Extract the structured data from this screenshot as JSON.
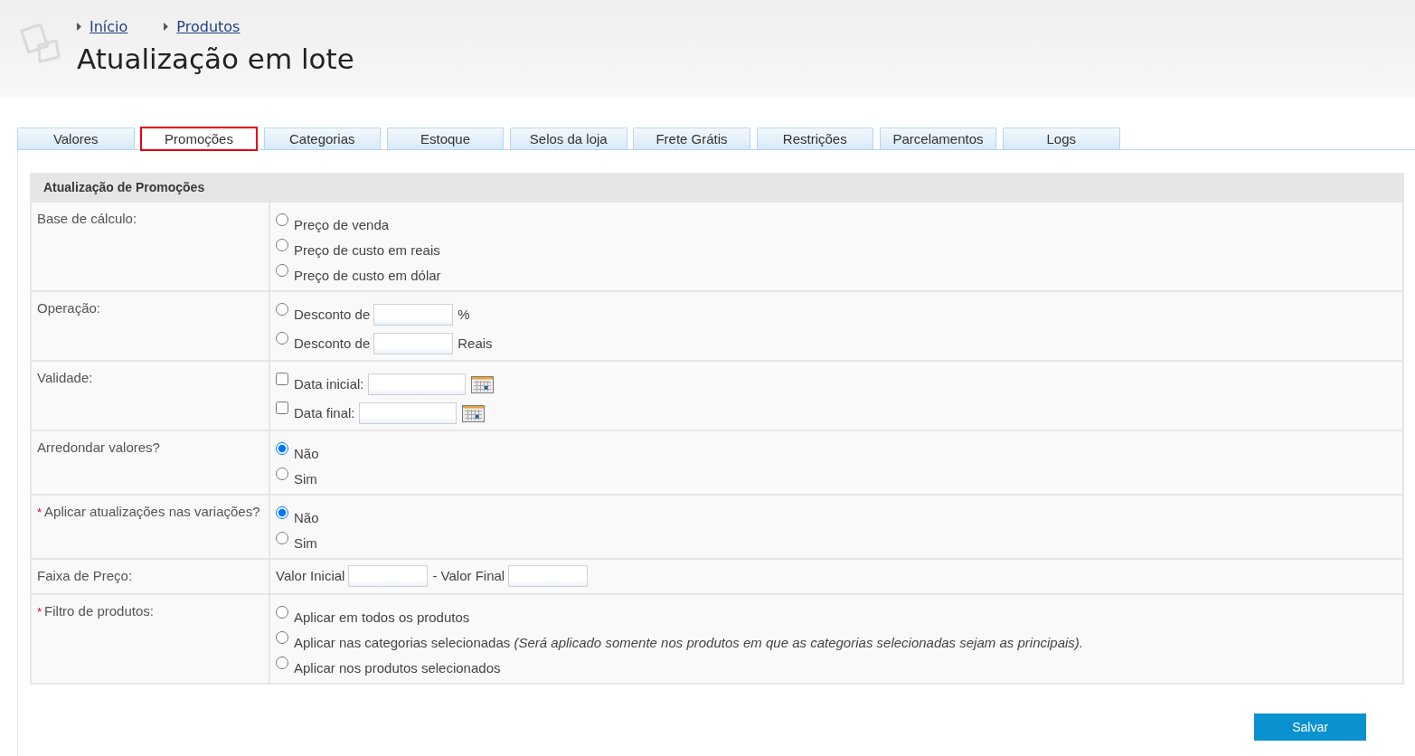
{
  "header": {
    "breadcrumbs": [
      {
        "label": "Início"
      },
      {
        "label": "Produtos"
      }
    ],
    "title": "Atualização em lote"
  },
  "tabs": [
    {
      "label": "Valores",
      "selected": false
    },
    {
      "label": "Promoções",
      "selected": true
    },
    {
      "label": "Categorias",
      "selected": false
    },
    {
      "label": "Estoque",
      "selected": false
    },
    {
      "label": "Selos da loja",
      "selected": false
    },
    {
      "label": "Frete Grátis",
      "selected": false
    },
    {
      "label": "Restrições",
      "selected": false
    },
    {
      "label": "Parcelamentos",
      "selected": false
    },
    {
      "label": "Logs",
      "selected": false
    }
  ],
  "form": {
    "title": "Atualização de Promoções",
    "rows": [
      {
        "label": "Base de cálculo:",
        "kind": "radio",
        "options": [
          {
            "label": "Preço de venda",
            "selected": false
          },
          {
            "label": "Preço de custo em reais",
            "selected": false
          },
          {
            "label": "Preço de custo em dólar",
            "selected": false
          }
        ]
      },
      {
        "label": "Operação:",
        "kind": "radio_input",
        "options": [
          {
            "label": "Desconto de",
            "selected": false,
            "suffix": "%"
          },
          {
            "label": "Desconto de",
            "selected": false,
            "suffix": "Reais"
          }
        ]
      },
      {
        "label": "Validade:",
        "kind": "check_date",
        "options": [
          {
            "label": "Data inicial:",
            "checked": false
          },
          {
            "label": "Data final:",
            "checked": false
          }
        ]
      },
      {
        "label": "Arredondar valores?",
        "kind": "radio",
        "options": [
          {
            "label": "Não",
            "selected": true
          },
          {
            "label": "Sim",
            "selected": false
          }
        ]
      },
      {
        "label": "Aplicar atualizações nas variações?",
        "required_mark": "*",
        "kind": "radio",
        "options": [
          {
            "label": "Não",
            "selected": true
          },
          {
            "label": "Sim",
            "selected": false
          }
        ]
      },
      {
        "label": "Faixa de Preço:",
        "kind": "range",
        "parts": [
          {
            "label": "Valor Inicial"
          },
          {
            "label": "- Valor Final"
          }
        ]
      },
      {
        "label": "Filtro de produtos:",
        "required_mark": "*",
        "kind": "radio",
        "options": [
          {
            "label": "Aplicar em todos os produtos",
            "selected": false
          },
          {
            "label": "Aplicar nas categorias selecionadas *(Será aplicado somente nos produtos em que as categorias selecionadas sejam as principais).*",
            "selected": false
          },
          {
            "label": "Aplicar nos produtos selecionados",
            "selected": false
          }
        ]
      }
    ]
  },
  "save_button": "Salvar"
}
